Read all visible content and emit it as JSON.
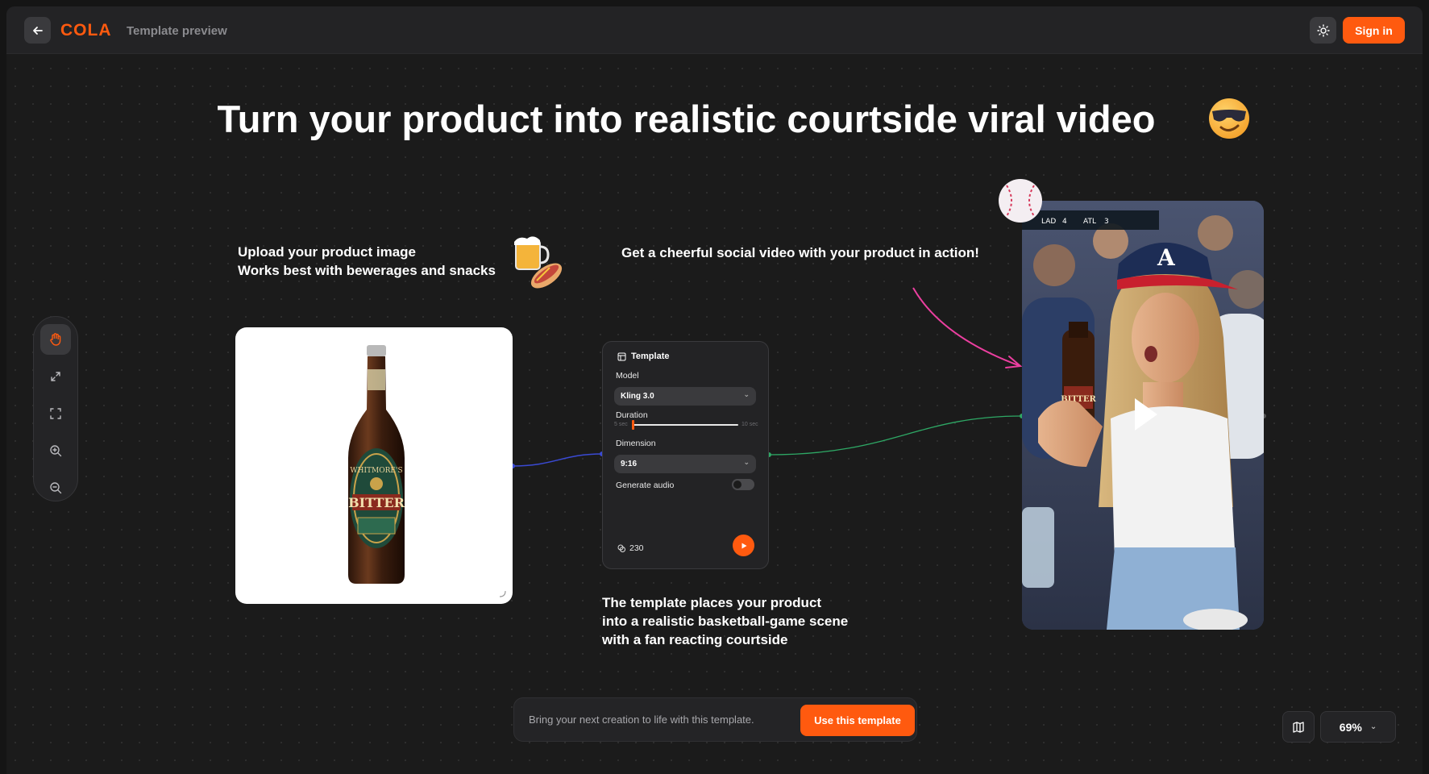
{
  "header": {
    "logo": "COLA",
    "subtitle": "Template preview",
    "sign_in": "Sign in"
  },
  "headline": "Turn your product into realistic courtside viral video",
  "captions": {
    "upload_line1": "Upload your product image",
    "upload_line2": "Works best with bewerages and snacks",
    "result": "Get a cheerful social video with your product in action!",
    "template_line1": "The template places your product",
    "template_line2": "into a realistic basketball-game scene",
    "template_line3": "with a fan reacting courtside"
  },
  "template_card": {
    "title": "Template",
    "model_label": "Model",
    "model_value": "Kling 3.0",
    "duration_label": "Duration",
    "duration_min": "5 sec",
    "duration_max": "10 sec",
    "duration_value": 0.0,
    "dimension_label": "Dimension",
    "dimension_value": "9:16",
    "audio_label": "Generate audio",
    "audio_on": false,
    "credits": "230"
  },
  "product": {
    "label_brand": "WHITMORE'S",
    "label_name": "BITTER"
  },
  "scoreboard": {
    "team1": "LAD",
    "score1": "4",
    "team2": "ATL",
    "score2": "3"
  },
  "bottom_bar": {
    "text": "Bring your next creation to life with this template.",
    "button": "Use this template"
  },
  "zoom": {
    "value": "69%"
  },
  "tools": [
    "hand-icon",
    "expand-icon",
    "fit-icon",
    "zoom-in-icon",
    "zoom-out-icon"
  ],
  "colors": {
    "accent": "#ff5a0f",
    "background": "#1b1b1b"
  }
}
